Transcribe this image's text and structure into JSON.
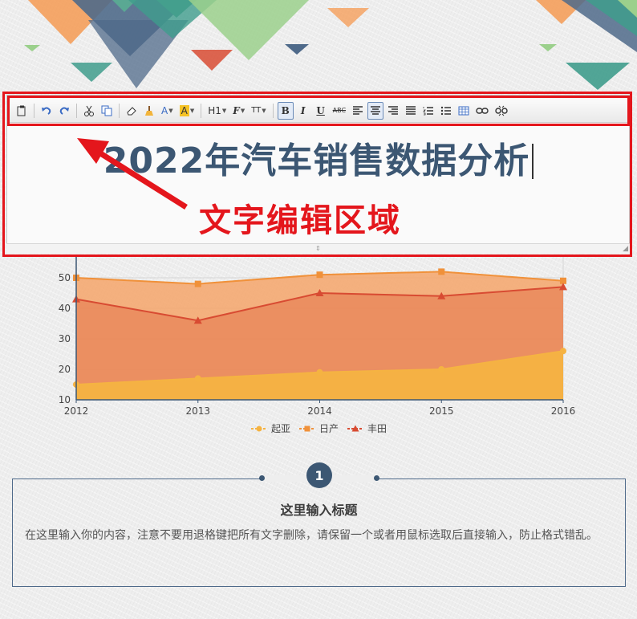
{
  "editor": {
    "title": "2022年汽车销售数据分析",
    "annotation_label": "文字编辑区域",
    "toolbar": {
      "heading_label": "H1",
      "font_label": "F",
      "size_label": "TT",
      "bold_label": "B",
      "italic_label": "I",
      "underline_label": "U",
      "strike_label": "ABC",
      "font_color_label": "A",
      "highlight_label": "A",
      "icons": [
        "paste-icon",
        "undo-icon",
        "redo-icon",
        "cut-icon",
        "copy-icon",
        "eraser-icon",
        "format-painter-icon",
        "font-color-icon",
        "highlight-icon",
        "heading-icon",
        "font-family-icon",
        "font-size-icon",
        "bold-icon",
        "italic-icon",
        "underline-icon",
        "strikethrough-icon",
        "align-left-icon",
        "align-center-icon",
        "align-right-icon",
        "justify-icon",
        "ordered-list-icon",
        "unordered-list-icon",
        "table-icon",
        "link-icon",
        "unlink-icon"
      ]
    }
  },
  "chart_data": {
    "type": "area",
    "x": [
      "2012",
      "2013",
      "2014",
      "2015",
      "2016"
    ],
    "series": [
      {
        "name": "起亚",
        "values": [
          15,
          17,
          19,
          20,
          26
        ],
        "color": "#f5b342",
        "marker": "circle"
      },
      {
        "name": "日产",
        "values": [
          50,
          48,
          51,
          52,
          49
        ],
        "color": "#f0913a",
        "marker": "square"
      },
      {
        "name": "丰田",
        "values": [
          43,
          36,
          45,
          44,
          47
        ],
        "color": "#d84b32",
        "marker": "triangle"
      }
    ],
    "yticks": [
      "10",
      "20",
      "30",
      "40",
      "50"
    ],
    "ylim": [
      10,
      50
    ],
    "grid": true,
    "legend_position": "bottom"
  },
  "card": {
    "number": "1",
    "title": "这里输入标题",
    "body": "在这里输入你的内容，注意不要用退格键把所有文字删除，请保留一个或者用鼠标选取后直接输入，防止格式错乱。"
  }
}
